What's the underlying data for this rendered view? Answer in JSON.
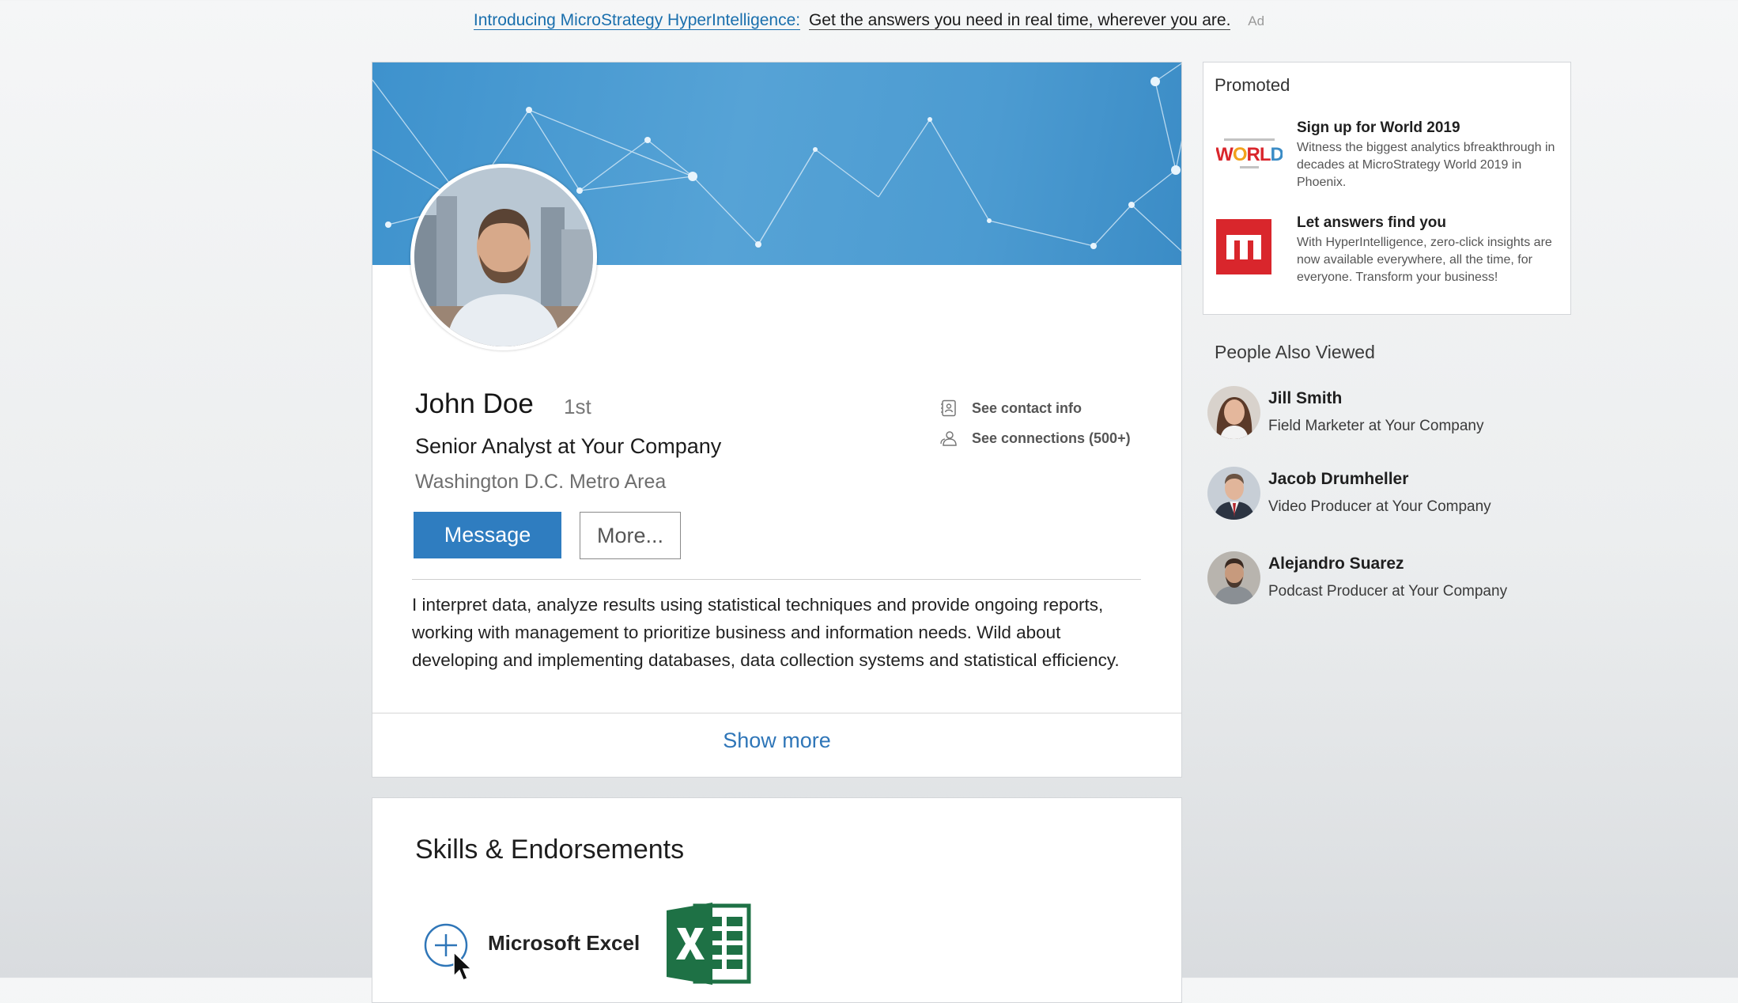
{
  "ad": {
    "link": "Introducing MicroStrategy HyperIntelligence:",
    "text": "Get the answers you need in real time, wherever you are.",
    "tag": "Ad"
  },
  "profile": {
    "name": "John Doe",
    "degree": "1st",
    "headline": "Senior Analyst at Your Company",
    "location": "Washington D.C. Metro Area",
    "contact_info": "See contact info",
    "connections": "See connections (500+)",
    "message_button": "Message",
    "more_button": "More...",
    "summary": "I interpret data, analyze results using statistical techniques and provide ongoing reports, working with management to prioritize business and information needs. Wild about developing and implementing databases, data collection systems and statistical efficiency.",
    "show_more": "Show more"
  },
  "skills": {
    "title": "Skills & Endorsements",
    "items": [
      {
        "name": "Microsoft Excel"
      }
    ]
  },
  "promoted": {
    "heading": "Promoted",
    "items": [
      {
        "title": "Sign up for World 2019",
        "description": "Witness the biggest analytics bfreakthrough in decades at MicroStrategy World 2019 in Phoenix."
      },
      {
        "title": "Let answers find you",
        "description": "With HyperIntelligence, zero-click insights are now available everywhere, all the time, for everyone. Transform your business!"
      }
    ]
  },
  "people_also_viewed": {
    "heading": "People Also Viewed",
    "people": [
      {
        "name": "Jill Smith",
        "title": "Field Marketer at Your Company"
      },
      {
        "name": "Jacob Drumheller",
        "title": "Video Producer at Your Company"
      },
      {
        "name": "Alejandro Suarez",
        "title": "Podcast Producer at Your Company"
      }
    ]
  },
  "colors": {
    "brand_blue": "#2f7dc0",
    "banner_blue": "#4c9bd1",
    "microstrategy_red": "#d9262c",
    "excel_green": "#1e7145"
  }
}
